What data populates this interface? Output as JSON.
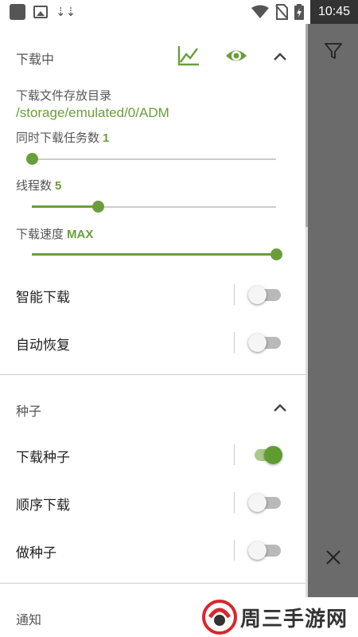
{
  "status_bar": {
    "time": "10:45",
    "icons": [
      "app-icon",
      "image-icon",
      "download-icon",
      "wifi-icon",
      "no-sim-icon",
      "battery-icon"
    ]
  },
  "downloading": {
    "title": "下载中",
    "header_icons": [
      "chart-icon",
      "eye-icon",
      "chevron-up-icon"
    ],
    "folder_label": "下载文件存放目录",
    "folder_path": "/storage/emulated/0/ADM",
    "tasks_label": "同时下载任务数",
    "tasks_value": "1",
    "tasks_fraction": 0.0,
    "threads_label": "线程数",
    "threads_value": "5",
    "threads_fraction": 0.27,
    "speed_label": "下载速度",
    "speed_value": "MAX",
    "speed_fraction": 1.0,
    "smart_label": "智能下载",
    "smart_on": false,
    "resume_label": "自动恢复",
    "resume_on": false
  },
  "torrent": {
    "title": "种子",
    "download_label": "下载种子",
    "download_on": true,
    "sequential_label": "顺序下载",
    "sequential_on": false,
    "seed_label": "做种子",
    "seed_on": false
  },
  "notify": {
    "title": "通知"
  },
  "overlay": {
    "icons": [
      "filter-icon",
      "close-icon"
    ]
  },
  "watermark": {
    "text": "周三手游网"
  },
  "colors": {
    "accent": "#6a9e3a",
    "overlay": "#6b6b6b"
  }
}
